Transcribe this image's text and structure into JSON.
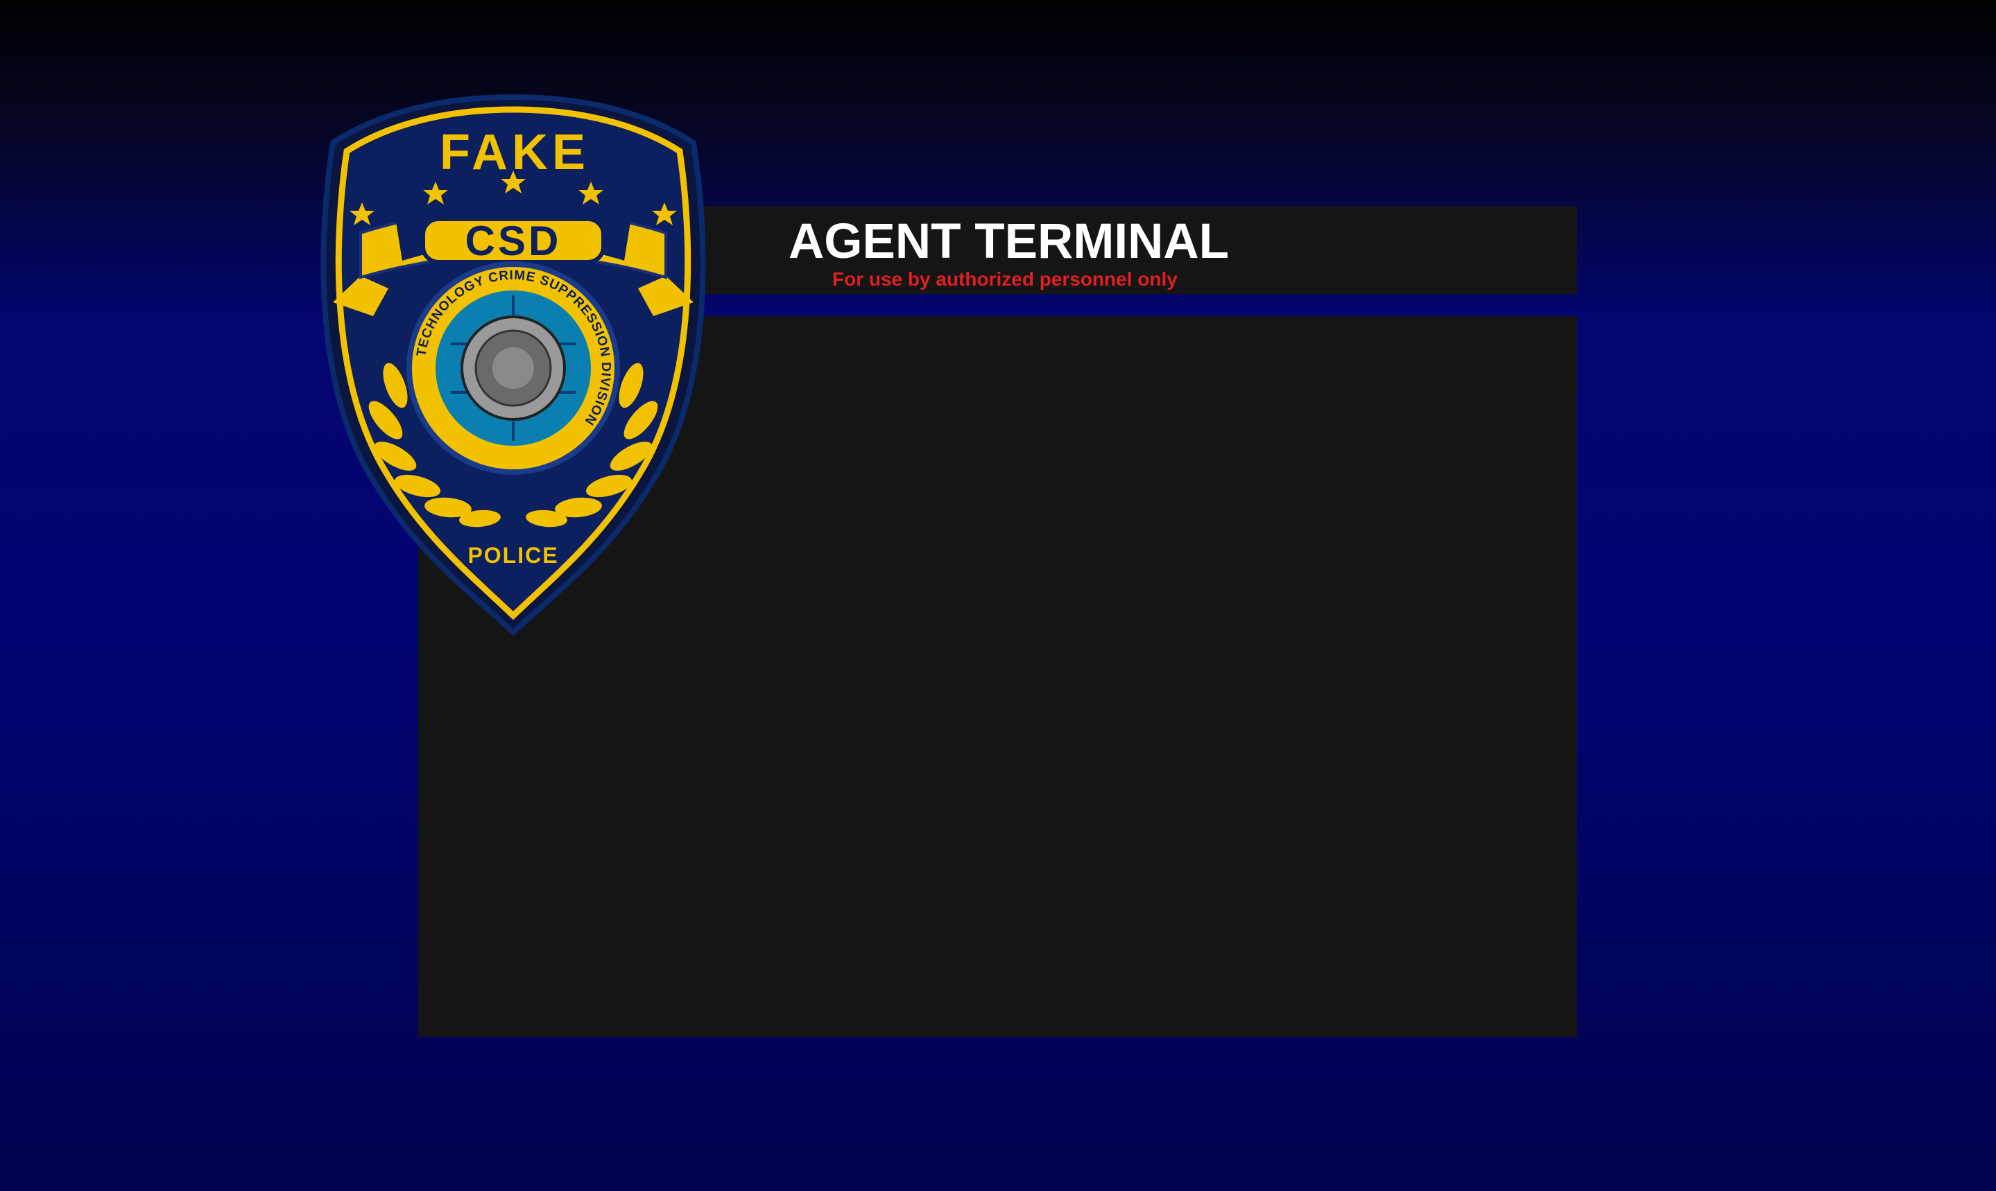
{
  "window": {
    "title": "AGENT TERMINAL",
    "subtitle": "For use by authorized personnel only"
  },
  "badge": {
    "icon": "police-badge-icon",
    "top_text": "FAKE",
    "banner_text": "CSD",
    "ring_text": "TECHNOLOGY CRIME SUPPRESSION DIVISION",
    "bottom_text": "POLICE"
  },
  "colors": {
    "panel": "#151515",
    "title": "#ffffff",
    "subtitle": "#e01f1f",
    "badge_gold": "#f2c200",
    "badge_navy": "#0a1a4a",
    "background_top": "#000000",
    "background_bottom": "#030474"
  }
}
